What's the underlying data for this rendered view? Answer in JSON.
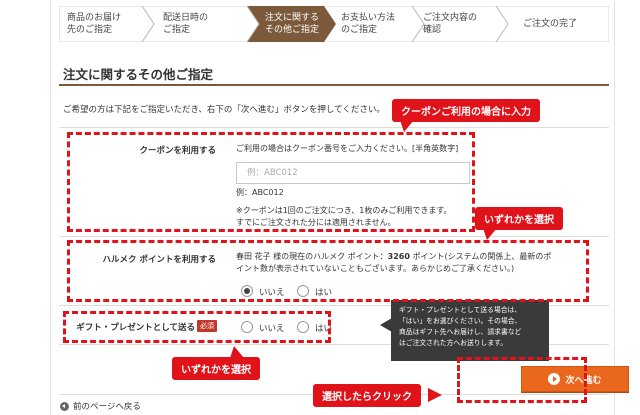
{
  "steps": [
    {
      "line1": "商品のお届け",
      "line2": "先のご指定",
      "active": false
    },
    {
      "line1": "配送日時の",
      "line2": "ご指定",
      "active": false
    },
    {
      "line1": "注文に関する",
      "line2": "その他ご指定",
      "active": true
    },
    {
      "line1": "お支払い方法",
      "line2": "のご指定",
      "active": false
    },
    {
      "line1": "ご注文内容の",
      "line2": "確認",
      "active": false
    },
    {
      "line1": "ご注文の完了",
      "line2": "",
      "active": false
    }
  ],
  "page_title": "注文に関するその他ご指定",
  "intro": "ご希望の方は下記をご指定いただき、右下の「次へ進む」ボタンを押してください。",
  "coupon": {
    "label": "クーポンを利用する",
    "instruction": "ご利用の場合はクーポン番号をご入力ください。[半角英数字]",
    "placeholder": "例：ABC012",
    "example": "例：ABC012",
    "note1": "※クーポンは1回のご注文につき、1枚のみご利用できます。",
    "note2": "すでにご注文された分には適用されません。"
  },
  "points": {
    "label": "ハルメク ポイントを利用する",
    "text1_pre": "春田 花子 様の現在のハルメク ポイント：",
    "points_value": "3260",
    "text1_post": " ポイント(システムの関係上、最新のポ",
    "text2": "イント数が表示されていないこともございます。あらかじめご了承ください。)",
    "option_no": "いいえ",
    "option_yes": "はい",
    "selected": "no"
  },
  "gift": {
    "label": "ギフト・プレゼントとして送る",
    "badge": "必須",
    "option_no": "いいえ",
    "option_yes": "はい"
  },
  "tooltip": {
    "line1": "ギフト・プレゼントとして送る場合は、",
    "line2": "「はい」をお選びください。その場合、",
    "line3": "商品はギフト先へお届けし、請求書など",
    "line4": "はご注文された方へお送りします。"
  },
  "callouts": {
    "coupon": "クーポンご利用の場合に入力",
    "points": "いずれかを選択",
    "gift": "いずれかを選択",
    "next": "選択したらクリック"
  },
  "next_button": "次へ進む",
  "back_link": "前のページへ戻る",
  "colors": {
    "accent": "#7a5a3a",
    "annotation": "#e0121a",
    "button": "#e9681e"
  }
}
